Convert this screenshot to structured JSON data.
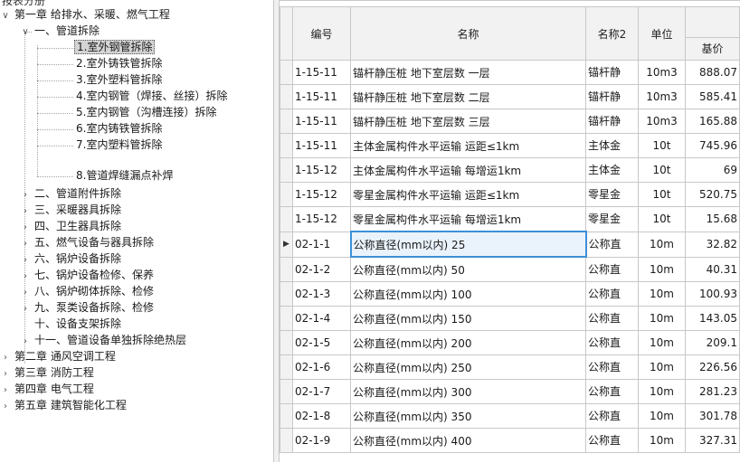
{
  "tree": {
    "header": "按表分册",
    "chapters": [
      {
        "label": "第一章 给排水、采暖、燃气工程",
        "expanded": true
      },
      {
        "label": "第二章 通风空调工程",
        "expanded": false
      },
      {
        "label": "第三章 消防工程",
        "expanded": false
      },
      {
        "label": "第四章 电气工程",
        "expanded": false
      },
      {
        "label": "第五章 建筑智能化工程",
        "expanded": false
      }
    ],
    "sections": [
      {
        "label": "一、管道拆除",
        "expanded": true
      },
      {
        "label": "二、管道附件拆除"
      },
      {
        "label": "三、采暖器具拆除"
      },
      {
        "label": "四、卫生器具拆除"
      },
      {
        "label": "五、燃气设备与器具拆除"
      },
      {
        "label": "六、锅炉设备拆除"
      },
      {
        "label": "七、锅炉设备检修、保养"
      },
      {
        "label": "八、锅炉砌体拆除、检修"
      },
      {
        "label": "九、泵类设备拆除、检修"
      },
      {
        "label": "十、设备支架拆除"
      },
      {
        "label": "十一、管道设备单独拆除绝热层"
      }
    ],
    "subitems": [
      {
        "label": "1.室外钢管拆除",
        "selected": true
      },
      {
        "label": "2.室外铸铁管拆除"
      },
      {
        "label": "3.室外塑料管拆除"
      },
      {
        "label": "4.室内钢管（焊接、丝接）拆除"
      },
      {
        "label": "5.室内钢管（沟槽连接）拆除"
      },
      {
        "label": "6.室内铸铁管拆除"
      },
      {
        "label": "7.室内塑料管拆除"
      },
      {
        "label": "8.管道焊缝漏点补焊"
      }
    ]
  },
  "grid": {
    "headers": {
      "code": "编号",
      "name": "名称",
      "name2": "名称2",
      "unit": "单位",
      "base_price": "基价"
    },
    "rows": [
      {
        "code": "1-15-11",
        "name": "锚杆静压桩 地下室层数 一层",
        "name2": "锚杆静",
        "unit": "10m3",
        "price": "888.07"
      },
      {
        "code": "1-15-11",
        "name": "锚杆静压桩 地下室层数 二层",
        "name2": "锚杆静",
        "unit": "10m3",
        "price": "585.41"
      },
      {
        "code": "1-15-11",
        "name": "锚杆静压桩 地下室层数 三层",
        "name2": "锚杆静",
        "unit": "10m3",
        "price": "165.88"
      },
      {
        "code": "1-15-11",
        "name": "主体金属构件水平运输 运距≤1km",
        "name2": "主体金",
        "unit": "10t",
        "price": "745.96"
      },
      {
        "code": "1-15-12",
        "name": "主体金属构件水平运输 每增运1km",
        "name2": "主体金",
        "unit": "10t",
        "price": "69"
      },
      {
        "code": "1-15-12",
        "name": "零星金属构件水平运输 运距≤1km",
        "name2": "零星金",
        "unit": "10t",
        "price": "520.75"
      },
      {
        "code": "1-15-12",
        "name": "零星金属构件水平运输 每增运1km",
        "name2": "零星金",
        "unit": "10t",
        "price": "15.68"
      },
      {
        "code": "02-1-1",
        "name": "公称直径(mm以内) 25",
        "name2": "公称直",
        "unit": "10m",
        "price": "32.82",
        "current": true
      },
      {
        "code": "02-1-2",
        "name": "公称直径(mm以内) 50",
        "name2": "公称直",
        "unit": "10m",
        "price": "40.31"
      },
      {
        "code": "02-1-3",
        "name": "公称直径(mm以内) 100",
        "name2": "公称直",
        "unit": "10m",
        "price": "100.93"
      },
      {
        "code": "02-1-4",
        "name": "公称直径(mm以内) 150",
        "name2": "公称直",
        "unit": "10m",
        "price": "143.05"
      },
      {
        "code": "02-1-5",
        "name": "公称直径(mm以内) 200",
        "name2": "公称直",
        "unit": "10m",
        "price": "209.1"
      },
      {
        "code": "02-1-6",
        "name": "公称直径(mm以内) 250",
        "name2": "公称直",
        "unit": "10m",
        "price": "226.56"
      },
      {
        "code": "02-1-7",
        "name": "公称直径(mm以内) 300",
        "name2": "公称直",
        "unit": "10m",
        "price": "281.23"
      },
      {
        "code": "02-1-8",
        "name": "公称直径(mm以内) 350",
        "name2": "公称直",
        "unit": "10m",
        "price": "301.78"
      },
      {
        "code": "02-1-9",
        "name": "公称直径(mm以内) 400",
        "name2": "公称直",
        "unit": "10m",
        "price": "327.31"
      }
    ]
  },
  "icons": {
    "expanded": "chevron-down-icon",
    "collapsed": "chevron-right-icon",
    "current_row": "triangle-right-icon"
  },
  "colors": {
    "selection_border": "#3d8fd9",
    "tree_selected_bg": "#d4d4d4"
  }
}
